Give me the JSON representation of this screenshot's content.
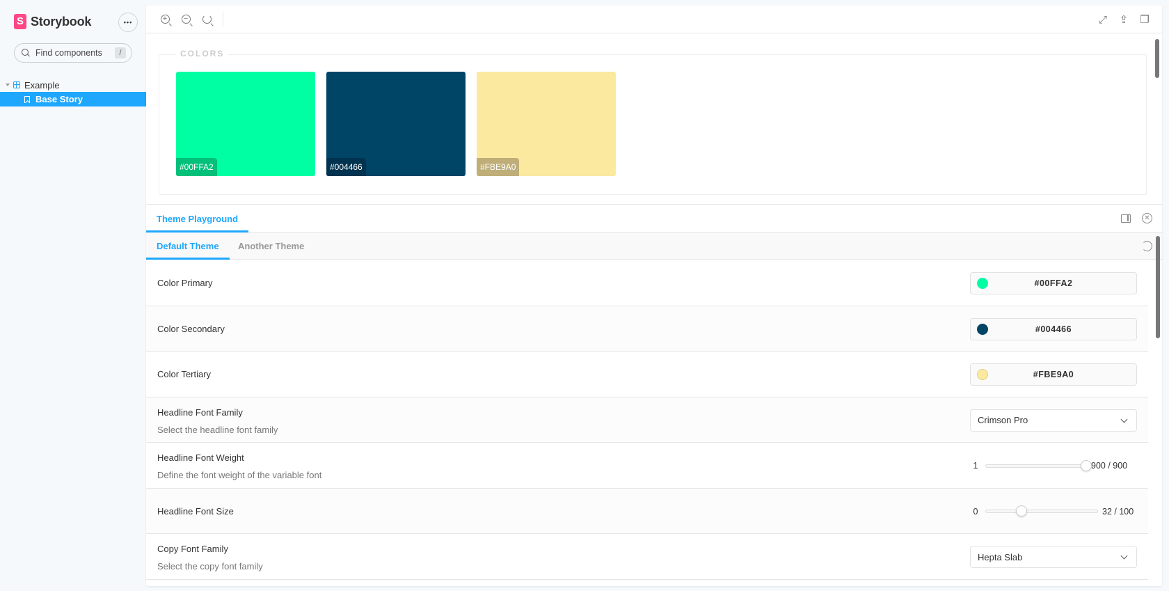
{
  "app": {
    "name": "Storybook",
    "logo_letter": "S",
    "menu_label": "•••"
  },
  "search": {
    "placeholder": "Find components",
    "shortcut": "/"
  },
  "sidebar": {
    "groups": [
      {
        "label": "Example",
        "expanded": true,
        "items": [
          {
            "label": "Base Story",
            "selected": true
          }
        ]
      }
    ]
  },
  "toolbar": {
    "left": [
      {
        "icon": "zoom-in-icon",
        "glyph": "+"
      },
      {
        "icon": "zoom-out-icon",
        "glyph": "−"
      },
      {
        "icon": "zoom-reset-icon",
        "glyph": ""
      }
    ],
    "right": [
      {
        "icon": "fullscreen-icon",
        "glyph": "⤢"
      },
      {
        "icon": "share-icon",
        "glyph": "⇪"
      },
      {
        "icon": "copy-icon",
        "glyph": "❐"
      }
    ]
  },
  "canvas": {
    "section_title": "COLORS",
    "swatches": [
      {
        "hex": "#00FFA2",
        "color": "#00ffa2",
        "label_bg": "#00c07a"
      },
      {
        "hex": "#004466",
        "color": "#004466",
        "label_bg": "#003350"
      },
      {
        "hex": "#FBE9A0",
        "color": "#fbe9a0",
        "label_bg": "#bfae78"
      }
    ]
  },
  "panel": {
    "tabs": [
      {
        "label": "Theme Playground",
        "active": true
      }
    ],
    "sub_tabs": [
      {
        "label": "Default Theme",
        "active": true
      },
      {
        "label": "Another Theme",
        "active": false
      }
    ],
    "controls": [
      {
        "type": "color",
        "label": "Color Primary",
        "value": "#00FFA2",
        "swatch": "#00ffa2"
      },
      {
        "type": "color",
        "label": "Color Secondary",
        "value": "#004466",
        "swatch": "#004466"
      },
      {
        "type": "color",
        "label": "Color Tertiary",
        "value": "#FBE9A0",
        "swatch": "#fbe9a0"
      },
      {
        "type": "select",
        "label": "Headline Font Family",
        "description": "Select the headline font family",
        "value": "Crimson Pro"
      },
      {
        "type": "range",
        "label": "Headline Font Weight",
        "description": "Define the font weight of the variable font",
        "min": 1,
        "max": 900,
        "value": 900,
        "min_label": "1",
        "value_label": "900 / 900"
      },
      {
        "type": "range",
        "label": "Headline Font Size",
        "min": 0,
        "max": 100,
        "value": 32,
        "min_label": "0",
        "value_label": "32 / 100"
      },
      {
        "type": "select",
        "label": "Copy Font Family",
        "description": "Select the copy font family",
        "value": "Hepta Slab"
      }
    ]
  },
  "colors": {
    "accent": "#1ea7fd",
    "brand": "#ff4785",
    "app_bg": "#f6f9fc"
  }
}
